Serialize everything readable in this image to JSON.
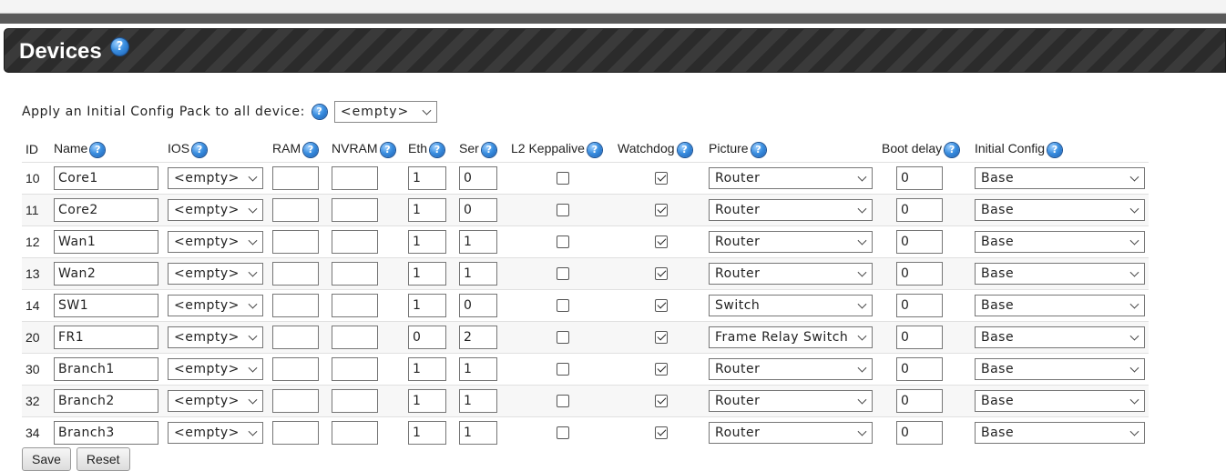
{
  "page": {
    "title": "Devices"
  },
  "apply": {
    "label": "Apply an Initial Config Pack to all device:",
    "selected": "<empty>"
  },
  "columns": {
    "id": "ID",
    "name": "Name",
    "ios": "IOS",
    "ram": "RAM",
    "nvram": "NVRAM",
    "eth": "Eth",
    "ser": "Ser",
    "l2": "L2 Keppalive",
    "watchdog": "Watchdog",
    "picture": "Picture",
    "boot": "Boot delay",
    "config": "Initial Config"
  },
  "rows": [
    {
      "id": "10",
      "name": "Core1",
      "ios": "<empty>",
      "ram": "",
      "nvram": "",
      "eth": "1",
      "ser": "0",
      "l2": false,
      "watchdog": true,
      "picture": "Router",
      "boot": "0",
      "config": "Base"
    },
    {
      "id": "11",
      "name": "Core2",
      "ios": "<empty>",
      "ram": "",
      "nvram": "",
      "eth": "1",
      "ser": "0",
      "l2": false,
      "watchdog": true,
      "picture": "Router",
      "boot": "0",
      "config": "Base"
    },
    {
      "id": "12",
      "name": "Wan1",
      "ios": "<empty>",
      "ram": "",
      "nvram": "",
      "eth": "1",
      "ser": "1",
      "l2": false,
      "watchdog": true,
      "picture": "Router",
      "boot": "0",
      "config": "Base"
    },
    {
      "id": "13",
      "name": "Wan2",
      "ios": "<empty>",
      "ram": "",
      "nvram": "",
      "eth": "1",
      "ser": "1",
      "l2": false,
      "watchdog": true,
      "picture": "Router",
      "boot": "0",
      "config": "Base"
    },
    {
      "id": "14",
      "name": "SW1",
      "ios": "<empty>",
      "ram": "",
      "nvram": "",
      "eth": "1",
      "ser": "0",
      "l2": false,
      "watchdog": true,
      "picture": "Switch",
      "boot": "0",
      "config": "Base"
    },
    {
      "id": "20",
      "name": "FR1",
      "ios": "<empty>",
      "ram": "",
      "nvram": "",
      "eth": "0",
      "ser": "2",
      "l2": false,
      "watchdog": true,
      "picture": "Frame Relay Switch",
      "boot": "0",
      "config": "Base"
    },
    {
      "id": "30",
      "name": "Branch1",
      "ios": "<empty>",
      "ram": "",
      "nvram": "",
      "eth": "1",
      "ser": "1",
      "l2": false,
      "watchdog": true,
      "picture": "Router",
      "boot": "0",
      "config": "Base"
    },
    {
      "id": "32",
      "name": "Branch2",
      "ios": "<empty>",
      "ram": "",
      "nvram": "",
      "eth": "1",
      "ser": "1",
      "l2": false,
      "watchdog": true,
      "picture": "Router",
      "boot": "0",
      "config": "Base"
    },
    {
      "id": "34",
      "name": "Branch3",
      "ios": "<empty>",
      "ram": "",
      "nvram": "",
      "eth": "1",
      "ser": "1",
      "l2": false,
      "watchdog": true,
      "picture": "Router",
      "boot": "0",
      "config": "Base"
    }
  ],
  "buttons": {
    "save": "Save",
    "reset": "Reset"
  },
  "icons": {
    "help": "help-icon",
    "checkbox": "checkmark-icon",
    "dropdown": "chevron-down-icon"
  },
  "colors": {
    "header_bg": "#2b2b2b",
    "help_blue": "#3b8fe0"
  }
}
